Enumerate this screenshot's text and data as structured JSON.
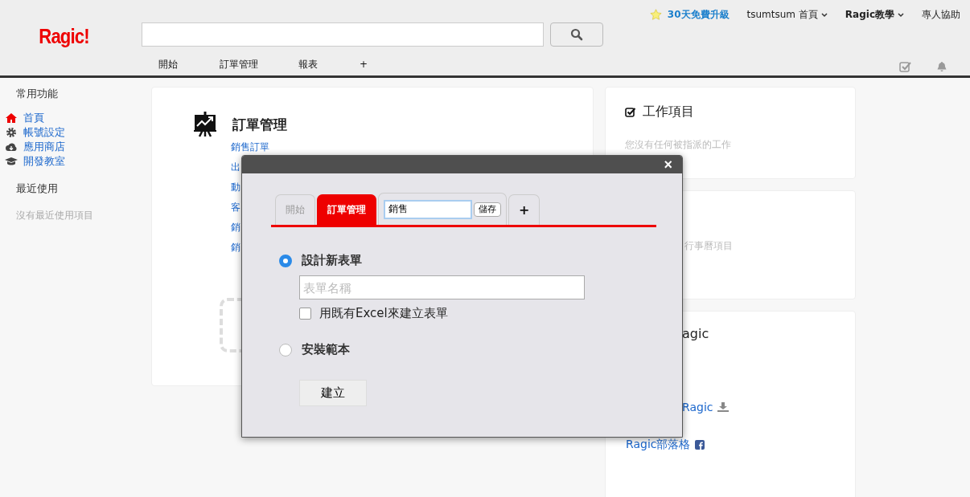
{
  "header": {
    "logo": "Ragic!",
    "nav": [
      {
        "label": "開始"
      },
      {
        "label": "訂單管理"
      },
      {
        "label": "報表"
      },
      {
        "label": "+"
      }
    ],
    "top_links": [
      {
        "kind": "upgrade",
        "label": "30天免費升級"
      },
      {
        "kind": "menu",
        "label": "tsumtsum 首頁"
      },
      {
        "kind": "menu-bold",
        "label": "Ragic教學"
      },
      {
        "kind": "plain",
        "label": "專人協助"
      }
    ]
  },
  "sidebar": {
    "sections": [
      {
        "title": "常用功能",
        "items": [
          {
            "label": "首頁",
            "selected": true
          },
          {
            "label": "帳號設定",
            "selected": false
          },
          {
            "label": "應用商店",
            "selected": false
          },
          {
            "label": "開發教室",
            "selected": false
          }
        ]
      },
      {
        "title": "最近使用",
        "empty_text": "沒有最近使用項目"
      }
    ]
  },
  "main_card": {
    "title": "訂單管理",
    "links": [
      "銷售訂單",
      "出",
      "動",
      "客",
      "銷",
      "銷"
    ]
  },
  "right_cards": [
    {
      "title": "工作項目",
      "text": "您沒有任何被指派的工作"
    },
    {
      "text": "行事曆項目"
    },
    {
      "title": "agic",
      "links": [
        {
          "label": "Ragic",
          "kind": "download"
        },
        {
          "label": "Ragic部落格",
          "kind": "facebook"
        }
      ]
    }
  ],
  "modal": {
    "close": "×",
    "tabs": [
      {
        "kind": "tab",
        "label": "開始",
        "selected": false
      },
      {
        "kind": "tab",
        "label": "訂單管理",
        "selected": true
      },
      {
        "kind": "edit",
        "value": "銷售",
        "button": "儲存",
        "selected": false
      },
      {
        "kind": "add",
        "label": "+",
        "selected": false
      }
    ],
    "options": [
      {
        "label": "設計新表單",
        "selected": true,
        "field_placeholder": "表單名稱",
        "checkbox": {
          "label": "用既有Excel來建立表單",
          "checked": false
        }
      },
      {
        "label": "安裝範本",
        "selected": false
      }
    ],
    "button": "建立"
  }
}
